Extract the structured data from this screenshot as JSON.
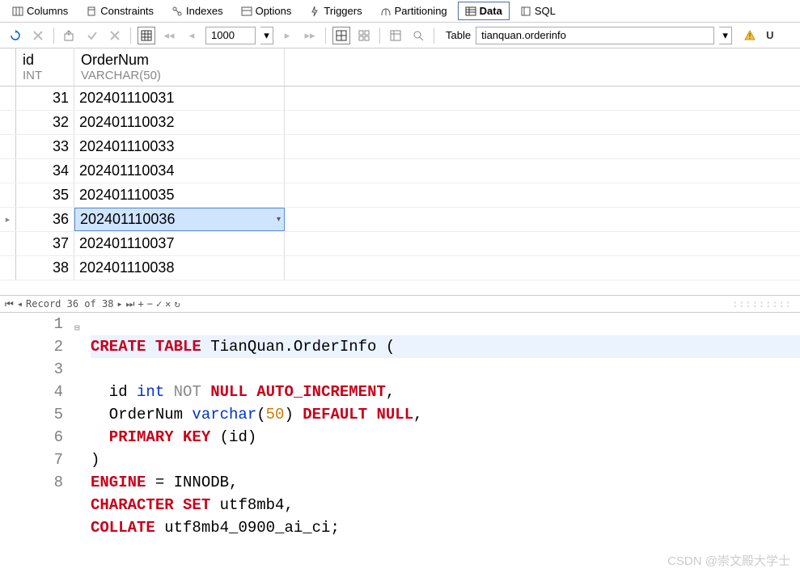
{
  "tabs": [
    {
      "label": "Columns"
    },
    {
      "label": "Constraints"
    },
    {
      "label": "Indexes"
    },
    {
      "label": "Options"
    },
    {
      "label": "Triggers"
    },
    {
      "label": "Partitioning"
    },
    {
      "label": "Data"
    },
    {
      "label": "SQL"
    }
  ],
  "toolbar": {
    "page_size": "1000",
    "table_label": "Table",
    "table_value": "tianquan.orderinfo",
    "warn_text": "U"
  },
  "columns": [
    {
      "name": "id",
      "type": "INT"
    },
    {
      "name": "OrderNum",
      "type": "VARCHAR(50)"
    }
  ],
  "rows": [
    {
      "id": "31",
      "ordernum": "202401110031"
    },
    {
      "id": "32",
      "ordernum": "202401110032"
    },
    {
      "id": "33",
      "ordernum": "202401110033"
    },
    {
      "id": "34",
      "ordernum": "202401110034"
    },
    {
      "id": "35",
      "ordernum": "202401110035"
    },
    {
      "id": "36",
      "ordernum": "202401110036",
      "selected": true
    },
    {
      "id": "37",
      "ordernum": "202401110037"
    },
    {
      "id": "38",
      "ordernum": "202401110038"
    }
  ],
  "status": {
    "record_text": "Record 36 of 38"
  },
  "sql_lines": {
    "l1a": "CREATE TABLE",
    "l1b": " TianQuan.OrderInfo (",
    "l2a": "  id ",
    "l2b": "int",
    "l2c": " NOT",
    "l2d": " NULL AUTO_INCREMENT",
    "l2e": ",",
    "l3a": "  OrderNum ",
    "l3b": "varchar",
    "l3c": "(",
    "l3d": "50",
    "l3e": ")",
    "l3f": " DEFAULT NULL",
    "l3g": ",",
    "l4a": "  PRIMARY KEY",
    "l4b": " (id)",
    "l5": ")",
    "l6a": "ENGINE",
    "l6b": " = INNODB,",
    "l7a": "CHARACTER SET",
    "l7b": " utf8mb4,",
    "l8a": "COLLATE",
    "l8b": " utf8mb4_0900_ai_ci;"
  },
  "line_numbers": [
    "1",
    "2",
    "3",
    "4",
    "5",
    "6",
    "7",
    "8"
  ],
  "watermark": "CSDN @崇文殿大学士"
}
